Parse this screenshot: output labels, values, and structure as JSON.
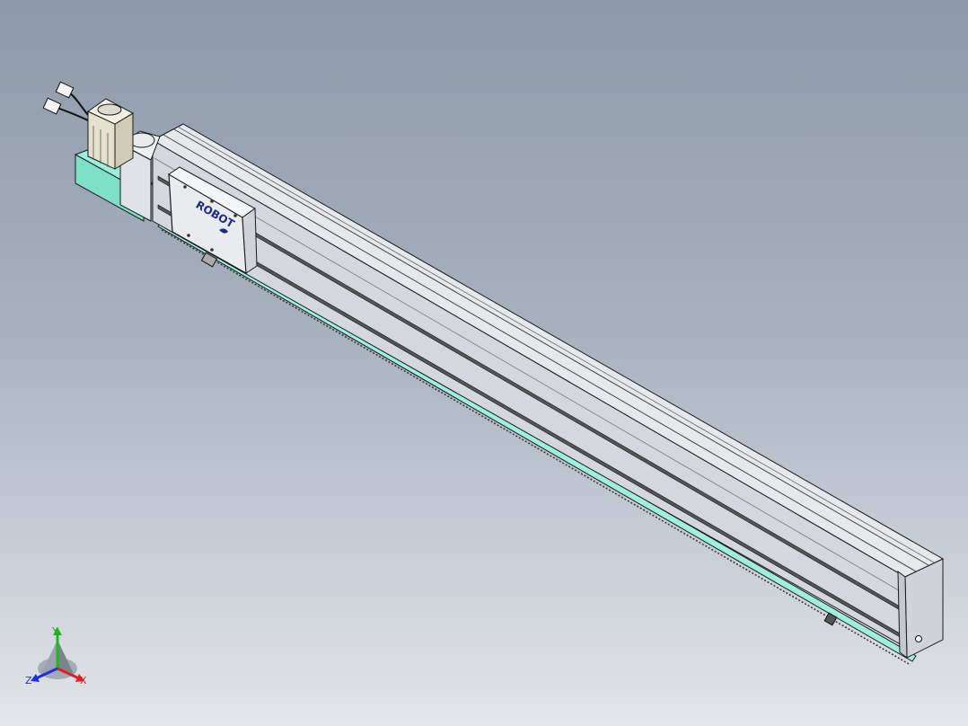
{
  "viewport": {
    "background_top": "#8c9aac",
    "background_bottom": "#e2e5e9"
  },
  "model": {
    "carriage_logo": "ROBOT",
    "colors": {
      "body": "#d8dbe0",
      "body_shadow": "#b8bdc6",
      "mount_block": "#7fe0c8",
      "edge_line": "#1a1a1a",
      "base_rail": "#9ef0dc"
    }
  },
  "triad": {
    "x_label": "X",
    "y_label": "Y",
    "z_label": "Z",
    "x_color": "#e02020",
    "y_color": "#1fb51f",
    "z_color": "#2030d8"
  }
}
